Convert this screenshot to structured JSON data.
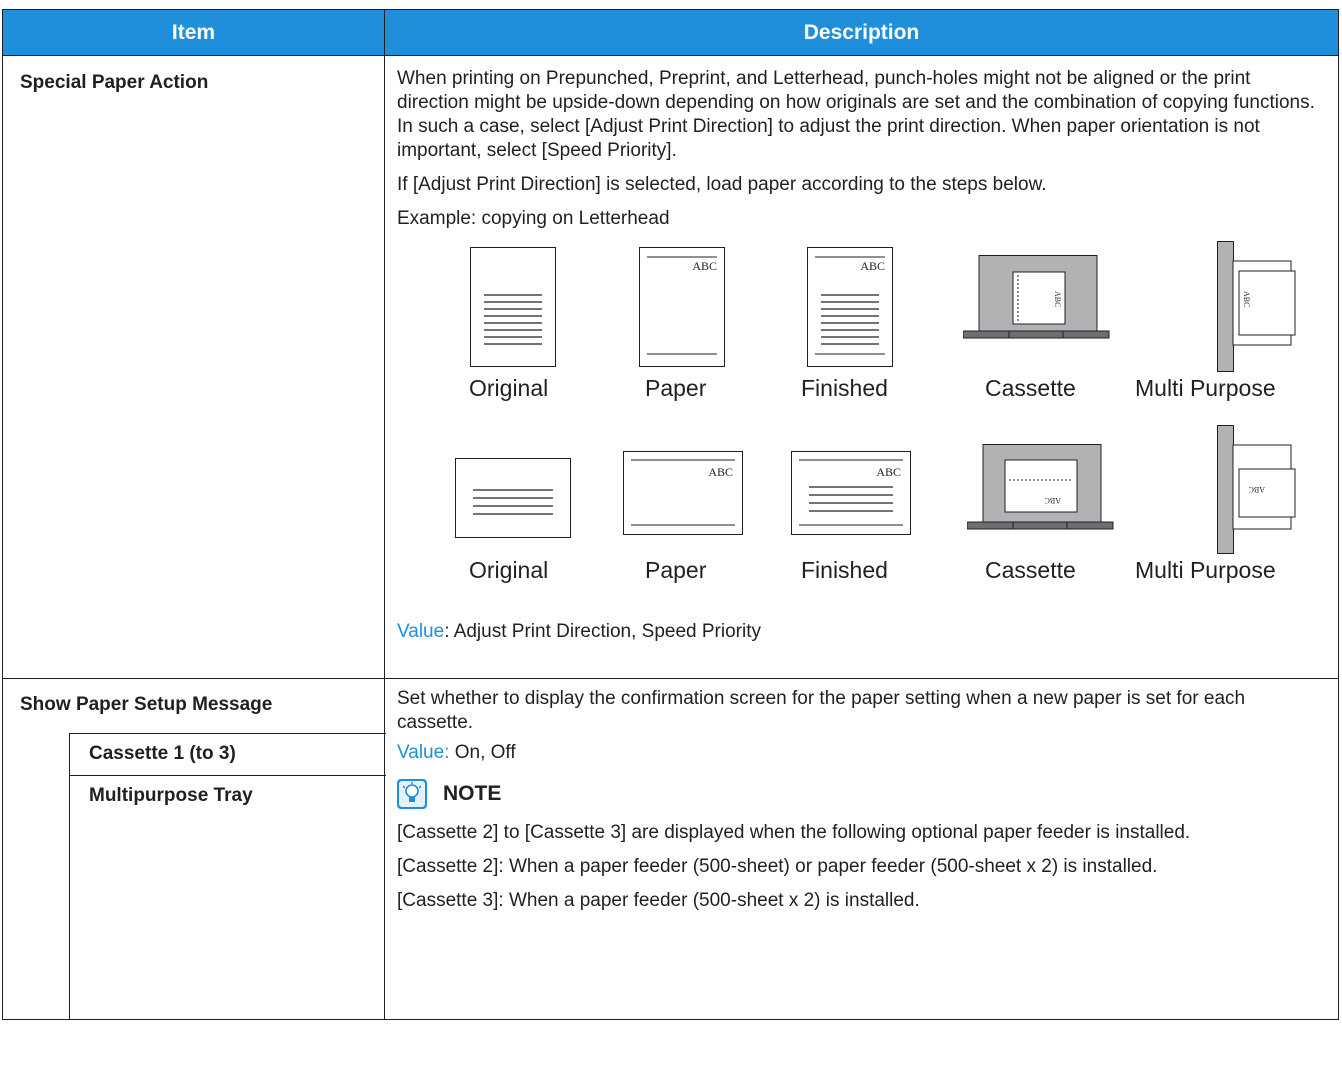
{
  "header": {
    "item": "Item",
    "description": "Description"
  },
  "row1": {
    "item": "Special Paper Action",
    "paragraphs": [
      "When printing on Prepunched, Preprint, and Letterhead, punch-holes might not be aligned or the print direction might be upside-down depending on how originals are set and the combination of copying functions. In such a case, select [Adjust Print Direction] to adjust the print direction. When paper orientation is not important, select [Speed Priority].",
      "If [Adjust Print Direction] is selected, load paper according to the steps below.",
      "Example: copying on Letterhead"
    ],
    "figure_labels": {
      "original": "Original",
      "paper": "Paper",
      "finished": "Finished",
      "cassette": "Cassette",
      "mp": "Multi Purpose"
    },
    "paper_mark": "ABC",
    "value_key": "Value",
    "value_text": ": Adjust Print Direction, Speed Priority"
  },
  "row2": {
    "item": "Show Paper Setup Message",
    "sub_items": [
      "Cassette 1 (to 3)",
      "Multipurpose Tray"
    ],
    "paragraph": "Set whether to display the confirmation screen for the paper setting when a new paper is set for each cassette.",
    "value_key": "Value:",
    "value_text": " On, Off",
    "note_title": "NOTE",
    "note_paragraphs": [
      "[Cassette 2] to [Cassette 3] are displayed when the following optional paper feeder is installed.",
      "[Cassette 2]: When a paper feeder (500-sheet) or paper feeder (500-sheet x 2) is installed.",
      "[Cassette 3]: When a paper feeder (500-sheet x 2) is installed."
    ]
  },
  "colors": {
    "header_bg": "#1f8fdc",
    "value_key": "#1f8fdc",
    "tray_gray": "#b0b2b4"
  }
}
